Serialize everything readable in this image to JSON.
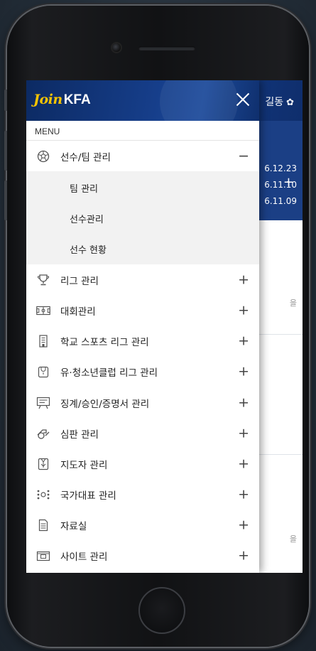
{
  "background_page": {
    "user_name": "길동",
    "user_icon": "gear-icon",
    "add_label": "+",
    "dates": [
      "6.12.23",
      "6.11.10",
      "6.11.09"
    ],
    "card_texts": [
      "을",
      "을"
    ]
  },
  "drawer": {
    "logo": {
      "join": "Join",
      "kfa": "KFA"
    },
    "close_icon": "close-icon",
    "menu_label": "MENU",
    "items": [
      {
        "label": "선수/팀 관리",
        "icon": "soccer-ball-icon",
        "toggle": "−",
        "expanded": true,
        "children": [
          "팀 관리",
          "선수관리",
          "선수 현황"
        ]
      },
      {
        "label": "리그 관리",
        "icon": "trophy-icon",
        "toggle": "+"
      },
      {
        "label": "대회관리",
        "icon": "scoreboard-icon",
        "toggle": "+"
      },
      {
        "label": "학교 스포츠 리그 관리",
        "icon": "school-building-icon",
        "toggle": "+"
      },
      {
        "label": "유·청소년클럽 리그 관리",
        "icon": "youth-jersey-icon",
        "toggle": "+"
      },
      {
        "label": "징계/승인/증명서 관리",
        "icon": "certificate-board-icon",
        "toggle": "+"
      },
      {
        "label": "심판 관리",
        "icon": "referee-whistle-icon",
        "toggle": "+"
      },
      {
        "label": "지도자 관리",
        "icon": "coach-shirt-icon",
        "toggle": "+"
      },
      {
        "label": "국가대표 관리",
        "icon": "national-team-icon",
        "toggle": "+"
      },
      {
        "label": "자료실",
        "icon": "document-icon",
        "toggle": "+"
      },
      {
        "label": "사이트 관리",
        "icon": "folder-site-icon",
        "toggle": "+"
      }
    ]
  },
  "colors": {
    "header_blue": "#133a84",
    "logo_yellow": "#f6c400",
    "submenu_bg": "#f2f2f2"
  }
}
